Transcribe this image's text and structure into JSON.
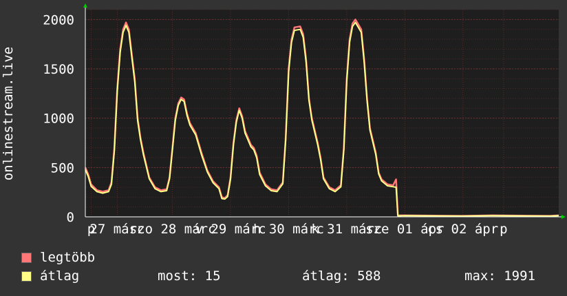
{
  "chart_data": {
    "type": "line",
    "ylabel": "onlinestream.live",
    "ylim": [
      0,
      2100
    ],
    "yticks": [
      0,
      500,
      1000,
      1500,
      2000
    ],
    "ytick_labels": [
      "0",
      "500",
      "1000",
      "1500",
      "2000"
    ],
    "x_range": [
      0,
      8.15
    ],
    "x_tick_labels": [
      {
        "label": "p",
        "x": 0.1
      },
      {
        "label": "27 márc",
        "x": 0.55
      },
      {
        "label": "szo 28 márc",
        "x": 1.5
      },
      {
        "label": "v 29 márc",
        "x": 2.5
      },
      {
        "label": "h 30 márc",
        "x": 3.5
      },
      {
        "label": "k 31 márc",
        "x": 4.5
      },
      {
        "label": "sze 01 ápr",
        "x": 5.5
      },
      {
        "label": "cs 02 ápr",
        "x": 6.5
      },
      {
        "label": "p",
        "x": 7.2
      }
    ],
    "grid": true,
    "series": [
      {
        "name": "legtöbb",
        "color": "#ff7777",
        "points": [
          [
            0,
            500
          ],
          [
            0.05,
            430
          ],
          [
            0.1,
            330
          ],
          [
            0.2,
            270
          ],
          [
            0.3,
            255
          ],
          [
            0.4,
            270
          ],
          [
            0.45,
            350
          ],
          [
            0.5,
            700
          ],
          [
            0.55,
            1300
          ],
          [
            0.6,
            1700
          ],
          [
            0.65,
            1900
          ],
          [
            0.7,
            1970
          ],
          [
            0.75,
            1900
          ],
          [
            0.8,
            1650
          ],
          [
            0.85,
            1400
          ],
          [
            0.9,
            1000
          ],
          [
            0.95,
            800
          ],
          [
            1.0,
            650
          ],
          [
            1.1,
            400
          ],
          [
            1.2,
            300
          ],
          [
            1.3,
            270
          ],
          [
            1.4,
            280
          ],
          [
            1.45,
            400
          ],
          [
            1.5,
            700
          ],
          [
            1.55,
            1000
          ],
          [
            1.6,
            1150
          ],
          [
            1.65,
            1210
          ],
          [
            1.7,
            1190
          ],
          [
            1.75,
            1050
          ],
          [
            1.8,
            950
          ],
          [
            1.9,
            850
          ],
          [
            2.0,
            650
          ],
          [
            2.1,
            470
          ],
          [
            2.2,
            360
          ],
          [
            2.3,
            300
          ],
          [
            2.35,
            200
          ],
          [
            2.4,
            190
          ],
          [
            2.45,
            220
          ],
          [
            2.5,
            400
          ],
          [
            2.55,
            750
          ],
          [
            2.6,
            980
          ],
          [
            2.65,
            1100
          ],
          [
            2.7,
            1020
          ],
          [
            2.75,
            870
          ],
          [
            2.8,
            800
          ],
          [
            2.85,
            730
          ],
          [
            2.9,
            700
          ],
          [
            2.95,
            620
          ],
          [
            3.0,
            450
          ],
          [
            3.1,
            330
          ],
          [
            3.2,
            280
          ],
          [
            3.3,
            270
          ],
          [
            3.4,
            350
          ],
          [
            3.45,
            800
          ],
          [
            3.5,
            1500
          ],
          [
            3.55,
            1800
          ],
          [
            3.6,
            1920
          ],
          [
            3.7,
            1930
          ],
          [
            3.75,
            1850
          ],
          [
            3.8,
            1600
          ],
          [
            3.85,
            1200
          ],
          [
            3.9,
            1000
          ],
          [
            4.0,
            750
          ],
          [
            4.05,
            600
          ],
          [
            4.1,
            400
          ],
          [
            4.2,
            300
          ],
          [
            4.3,
            270
          ],
          [
            4.4,
            320
          ],
          [
            4.45,
            700
          ],
          [
            4.5,
            1400
          ],
          [
            4.55,
            1800
          ],
          [
            4.6,
            1960
          ],
          [
            4.65,
            2000
          ],
          [
            4.7,
            1950
          ],
          [
            4.75,
            1900
          ],
          [
            4.8,
            1600
          ],
          [
            4.85,
            1200
          ],
          [
            4.9,
            900
          ],
          [
            5.0,
            650
          ],
          [
            5.05,
            450
          ],
          [
            5.1,
            380
          ],
          [
            5.2,
            330
          ],
          [
            5.3,
            320
          ],
          [
            5.35,
            380
          ],
          [
            5.38,
            15
          ],
          [
            5.5,
            15
          ],
          [
            6.0,
            12
          ],
          [
            6.5,
            10
          ],
          [
            7.0,
            15
          ],
          [
            7.5,
            12
          ],
          [
            8.0,
            10
          ],
          [
            8.15,
            15
          ]
        ]
      },
      {
        "name": "átlag",
        "color": "#ffff88",
        "points": [
          [
            0,
            480
          ],
          [
            0.05,
            410
          ],
          [
            0.1,
            310
          ],
          [
            0.2,
            255
          ],
          [
            0.3,
            240
          ],
          [
            0.4,
            255
          ],
          [
            0.45,
            330
          ],
          [
            0.5,
            670
          ],
          [
            0.55,
            1270
          ],
          [
            0.6,
            1670
          ],
          [
            0.65,
            1870
          ],
          [
            0.7,
            1940
          ],
          [
            0.75,
            1870
          ],
          [
            0.8,
            1620
          ],
          [
            0.85,
            1370
          ],
          [
            0.9,
            975
          ],
          [
            0.95,
            780
          ],
          [
            1.0,
            630
          ],
          [
            1.1,
            385
          ],
          [
            1.2,
            285
          ],
          [
            1.3,
            255
          ],
          [
            1.4,
            265
          ],
          [
            1.45,
            385
          ],
          [
            1.5,
            680
          ],
          [
            1.55,
            980
          ],
          [
            1.6,
            1130
          ],
          [
            1.65,
            1190
          ],
          [
            1.7,
            1170
          ],
          [
            1.75,
            1030
          ],
          [
            1.8,
            930
          ],
          [
            1.9,
            830
          ],
          [
            2.0,
            630
          ],
          [
            2.1,
            455
          ],
          [
            2.2,
            345
          ],
          [
            2.3,
            285
          ],
          [
            2.35,
            185
          ],
          [
            2.4,
            180
          ],
          [
            2.45,
            205
          ],
          [
            2.5,
            380
          ],
          [
            2.55,
            730
          ],
          [
            2.6,
            960
          ],
          [
            2.65,
            1080
          ],
          [
            2.7,
            1000
          ],
          [
            2.75,
            850
          ],
          [
            2.8,
            780
          ],
          [
            2.85,
            710
          ],
          [
            2.9,
            680
          ],
          [
            2.95,
            600
          ],
          [
            3.0,
            430
          ],
          [
            3.1,
            315
          ],
          [
            3.2,
            265
          ],
          [
            3.3,
            255
          ],
          [
            3.4,
            335
          ],
          [
            3.45,
            780
          ],
          [
            3.5,
            1470
          ],
          [
            3.55,
            1770
          ],
          [
            3.6,
            1890
          ],
          [
            3.7,
            1900
          ],
          [
            3.75,
            1820
          ],
          [
            3.8,
            1570
          ],
          [
            3.85,
            1180
          ],
          [
            3.9,
            980
          ],
          [
            4.0,
            730
          ],
          [
            4.05,
            580
          ],
          [
            4.1,
            385
          ],
          [
            4.2,
            285
          ],
          [
            4.3,
            255
          ],
          [
            4.4,
            305
          ],
          [
            4.45,
            680
          ],
          [
            4.5,
            1370
          ],
          [
            4.55,
            1770
          ],
          [
            4.6,
            1930
          ],
          [
            4.65,
            1970
          ],
          [
            4.7,
            1920
          ],
          [
            4.75,
            1870
          ],
          [
            4.8,
            1570
          ],
          [
            4.85,
            1180
          ],
          [
            4.9,
            880
          ],
          [
            5.0,
            630
          ],
          [
            5.05,
            435
          ],
          [
            5.1,
            365
          ],
          [
            5.2,
            315
          ],
          [
            5.3,
            305
          ],
          [
            5.35,
            300
          ],
          [
            5.38,
            10
          ],
          [
            5.5,
            12
          ],
          [
            6.0,
            10
          ],
          [
            6.5,
            8
          ],
          [
            7.0,
            12
          ],
          [
            7.5,
            10
          ],
          [
            8.0,
            8
          ],
          [
            8.15,
            12
          ]
        ]
      }
    ]
  },
  "legend": [
    {
      "label": "legtöbb",
      "color": "#ff7777"
    },
    {
      "label": "átlag",
      "color": "#ffff88"
    }
  ],
  "stats": {
    "now": "most: 15",
    "avg": "átlag: 588",
    "max": "max: 1991"
  },
  "colors": {
    "background": "#333333",
    "plot_background": "#1e1e1e",
    "grid": "#5a2a2a",
    "axis": "#ffffff",
    "text": "#ffffff",
    "arrow": "#00cc00"
  }
}
